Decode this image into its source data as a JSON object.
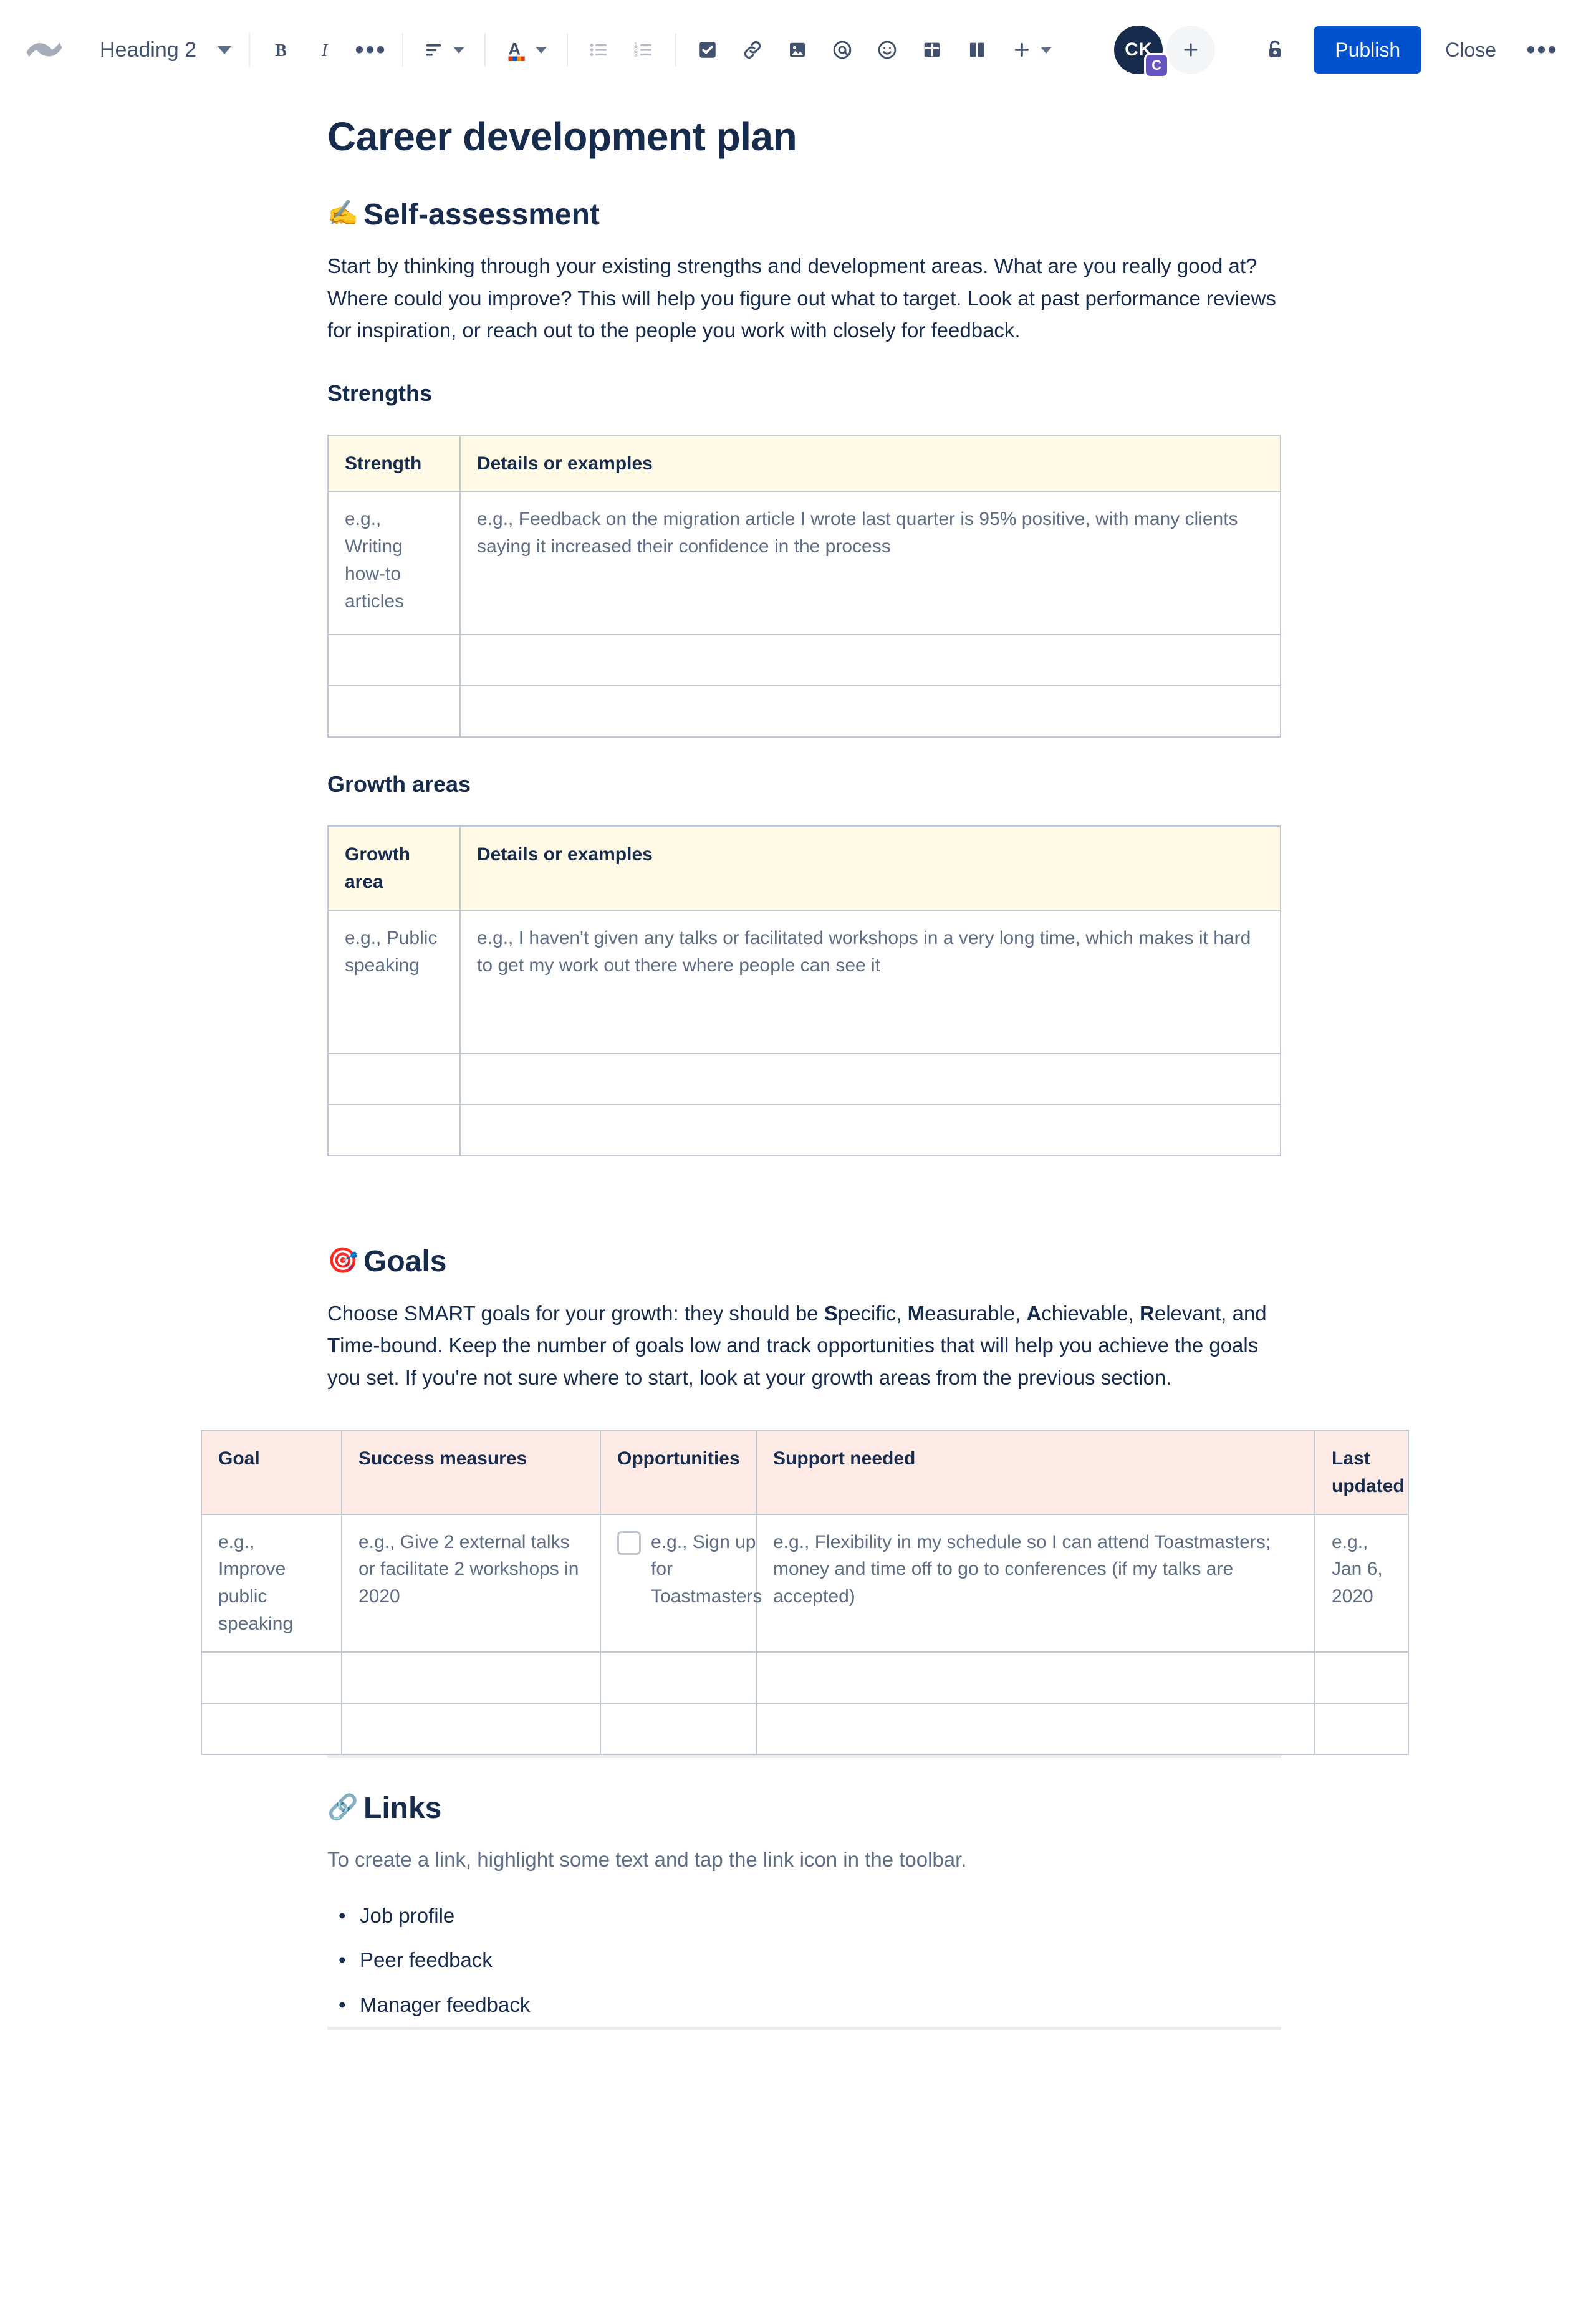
{
  "toolbar": {
    "logo": "confluence-logo",
    "style_select": {
      "value": "Heading 2",
      "icon": "chevron-down-icon"
    },
    "buttons": {
      "bold": "B",
      "italic": "I",
      "more_formatting": "•••",
      "text_align": "align-left-icon",
      "text_color": "text-color-icon",
      "bullet_list": "bullet-list-icon",
      "numbered_list": "numbered-list-icon",
      "task_list": "task-checkbox-icon",
      "link": "link-icon",
      "image": "image-icon",
      "mention": "mention-at-icon",
      "emoji": "emoji-smiley-icon",
      "table": "table-icon",
      "layout": "layout-columns-icon",
      "insert_more": "plus-icon"
    },
    "avatar": {
      "initials": "CK",
      "badge": "C"
    },
    "add_person": "plus-icon",
    "restrictions": "unlock-icon",
    "publish_label": "Publish",
    "close_label": "Close",
    "overflow": "•••"
  },
  "colors": {
    "primary": "#0052CC",
    "text": "#172B4D",
    "subtle_text": "#5E6C84",
    "table_header_yellow": "#FFFAE6",
    "table_header_pink": "#FFEBE6",
    "table_border": "#C1C7D0",
    "avatar_bg": "#172B4D",
    "badge_bg": "#6554C0",
    "rule": "#EBECF0"
  },
  "document": {
    "title": "Career development plan",
    "sections": {
      "self_assessment": {
        "emoji": "✍️",
        "emoji_name": "writing-hand-emoji",
        "heading": "Self-assessment",
        "intro": "Start by thinking through your existing strengths and development areas. What are you really good at? Where could you improve? This will help you figure out what to target. Look at past performance reviews for inspiration, or reach out to the people you work with closely for feedback.",
        "strengths": {
          "heading": "Strengths",
          "columns": [
            "Strength",
            "Details or examples"
          ],
          "rows": [
            [
              "e.g., Writing how-to articles",
              "e.g., Feedback on the migration article I wrote last quarter is 95% positive, with many clients saying it increased their confidence in the process"
            ],
            [
              "",
              ""
            ],
            [
              "",
              ""
            ]
          ]
        },
        "growth": {
          "heading": "Growth areas",
          "columns": [
            "Growth area",
            "Details or examples"
          ],
          "rows": [
            [
              "e.g., Public speaking",
              "e.g., I haven't given any talks or facilitated workshops in a very long time, which makes it hard to get my work out there where people can see it"
            ],
            [
              "",
              ""
            ],
            [
              "",
              ""
            ]
          ]
        }
      },
      "goals": {
        "emoji": "🎯",
        "emoji_name": "direct-hit-target-emoji",
        "heading": "Goals",
        "intro_part1": "Choose SMART goals for your growth: they should be ",
        "smart": {
          "s": "S",
          "s_rest": "pecific, ",
          "m": "M",
          "m_rest": "easurable, ",
          "a": "A",
          "a_rest": "chievable, ",
          "r": "R",
          "r_rest": "elevant, and ",
          "t": "T",
          "t_rest": "ime-bound."
        },
        "intro_part2": " Keep the number of goals low and track opportunities that will help you achieve the goals you set. If you're not sure where to start, look at your growth areas from the previous section.",
        "columns": [
          "Goal",
          "Success measures",
          "Opportunities",
          "Support needed",
          "Last updated"
        ],
        "rows": [
          {
            "goal": "e.g., Improve public speaking",
            "success": "e.g., Give 2 external talks or facilitate 2 workshops in 2020",
            "opportunity": "e.g., Sign up for Toastmasters",
            "opportunity_checked": false,
            "support": "e.g., Flexibility in my schedule so I can attend Toastmasters; money and time off to go to conferences (if my talks are accepted)",
            "last_updated": "e.g., Jan 6, 2020"
          },
          {
            "goal": "",
            "success": "",
            "opportunity": "",
            "opportunity_checked": false,
            "support": "",
            "last_updated": ""
          },
          {
            "goal": "",
            "success": "",
            "opportunity": "",
            "opportunity_checked": false,
            "support": "",
            "last_updated": ""
          }
        ]
      },
      "links": {
        "emoji": "🔗",
        "emoji_name": "link-chain-emoji",
        "heading": "Links",
        "intro": "To create a link, highlight some text and tap the link icon in the toolbar.",
        "items": [
          "Job profile",
          "Peer feedback",
          "Manager feedback"
        ]
      }
    }
  }
}
